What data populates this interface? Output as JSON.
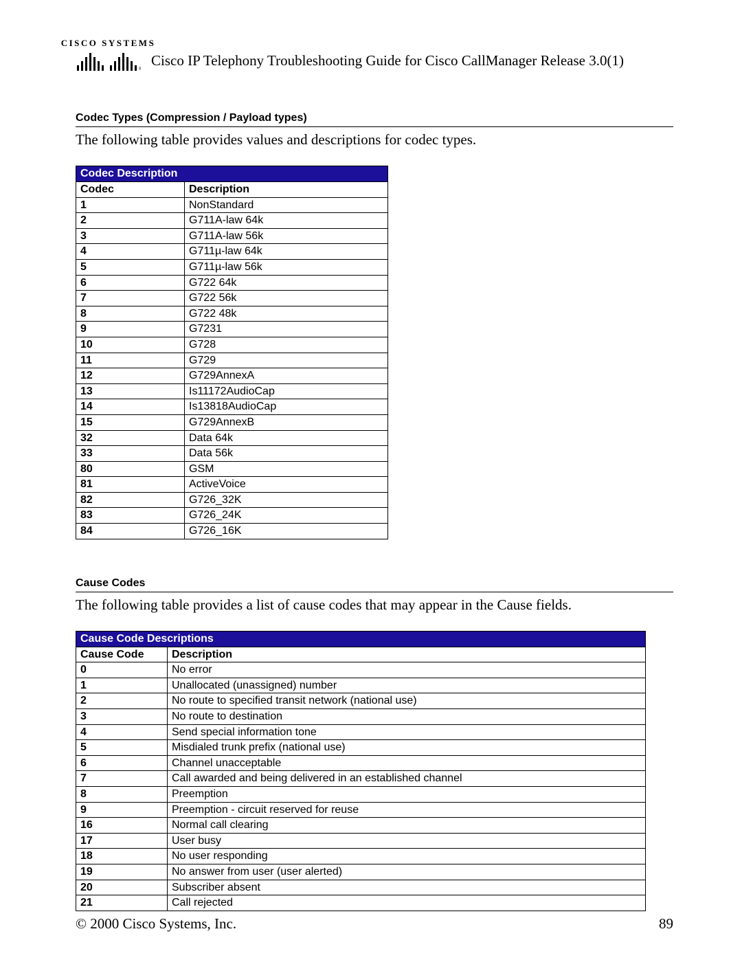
{
  "header": {
    "logo_text": "CISCO SYSTEMS",
    "doc_title": "Cisco IP Telephony Troubleshooting Guide for Cisco CallManager Release 3.0(1)"
  },
  "section1": {
    "heading": "Codec Types (Compression / Payload types)",
    "intro": "The following table provides values and descriptions for codec types.",
    "table_title": "Codec Description",
    "col1": "Codec",
    "col2": "Description",
    "rows": [
      {
        "code": "1",
        "desc": "NonStandard"
      },
      {
        "code": "2",
        "desc": "G711A-law 64k"
      },
      {
        "code": "3",
        "desc": "G711A-law 56k"
      },
      {
        "code": "4",
        "desc": "G711µ-law 64k"
      },
      {
        "code": "5",
        "desc": "G711µ-law 56k"
      },
      {
        "code": "6",
        "desc": "G722 64k"
      },
      {
        "code": "7",
        "desc": "G722 56k"
      },
      {
        "code": "8",
        "desc": "G722 48k"
      },
      {
        "code": "9",
        "desc": "G7231"
      },
      {
        "code": "10",
        "desc": "G728"
      },
      {
        "code": "11",
        "desc": "G729"
      },
      {
        "code": "12",
        "desc": "G729AnnexA"
      },
      {
        "code": "13",
        "desc": "Is11172AudioCap"
      },
      {
        "code": "14",
        "desc": "Is13818AudioCap"
      },
      {
        "code": "15",
        "desc": "G729AnnexB"
      },
      {
        "code": "32",
        "desc": "Data 64k"
      },
      {
        "code": "33",
        "desc": "Data 56k"
      },
      {
        "code": "80",
        "desc": "GSM"
      },
      {
        "code": "81",
        "desc": "ActiveVoice"
      },
      {
        "code": "82",
        "desc": "G726_32K"
      },
      {
        "code": "83",
        "desc": "G726_24K"
      },
      {
        "code": "84",
        "desc": "G726_16K"
      }
    ]
  },
  "section2": {
    "heading": "Cause Codes",
    "intro": "The following table provides a list of cause codes that may appear in the Cause fields.",
    "table_title": "Cause Code Descriptions",
    "col1": "Cause Code",
    "col2": "Description",
    "rows": [
      {
        "code": "0",
        "desc": "No error"
      },
      {
        "code": "1",
        "desc": "Unallocated (unassigned) number"
      },
      {
        "code": "2",
        "desc": "No route to specified transit network (national use)"
      },
      {
        "code": "3",
        "desc": "No route to destination"
      },
      {
        "code": "4",
        "desc": "Send special information tone"
      },
      {
        "code": "5",
        "desc": "Misdialed trunk prefix (national use)"
      },
      {
        "code": "6",
        "desc": "Channel unacceptable"
      },
      {
        "code": "7",
        "desc": "Call awarded and being delivered in an established channel"
      },
      {
        "code": "8",
        "desc": "Preemption"
      },
      {
        "code": "9",
        "desc": "Preemption - circuit reserved for reuse"
      },
      {
        "code": "16",
        "desc": "Normal call clearing"
      },
      {
        "code": "17",
        "desc": "User busy"
      },
      {
        "code": "18",
        "desc": "No user responding"
      },
      {
        "code": "19",
        "desc": "No answer from user (user alerted)"
      },
      {
        "code": "20",
        "desc": "Subscriber absent"
      },
      {
        "code": "21",
        "desc": "Call rejected"
      }
    ]
  },
  "footer": {
    "copyright": "© 2000 Cisco Systems, Inc.",
    "page_number": "89"
  }
}
